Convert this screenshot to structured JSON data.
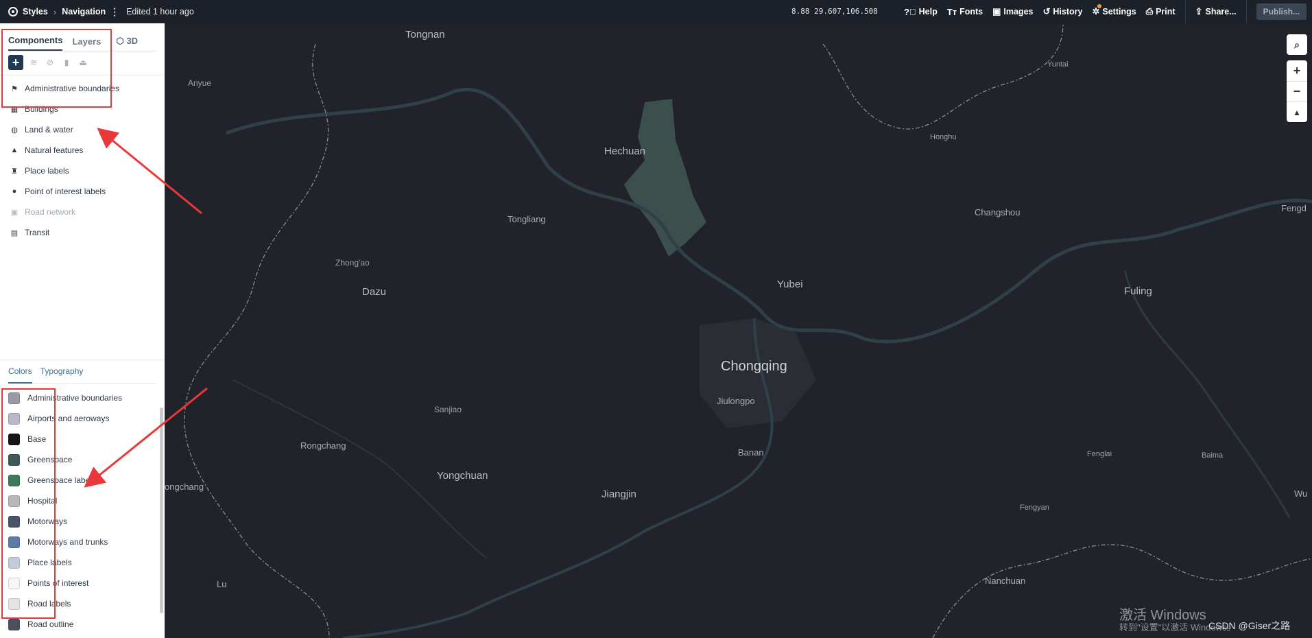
{
  "topbar": {
    "crumb_styles": "Styles",
    "crumb_navigation": "Navigation",
    "edited": "Edited 1 hour ago",
    "coords": "8.88 29.607,106.508",
    "menu": [
      {
        "label": "Help",
        "icon": "help-icon"
      },
      {
        "label": "Fonts",
        "icon": "fonts-icon"
      },
      {
        "label": "Images",
        "icon": "images-icon"
      },
      {
        "label": "History",
        "icon": "history-icon"
      },
      {
        "label": "Settings",
        "icon": "settings-icon"
      },
      {
        "label": "Print",
        "icon": "print-icon"
      },
      {
        "label": "Share...",
        "icon": "share-icon"
      }
    ],
    "publish": "Publish..."
  },
  "sidebar": {
    "tabs": [
      "Components",
      "Layers",
      "3D"
    ],
    "components": [
      {
        "label": "Administrative boundaries",
        "icon": "flag-icon"
      },
      {
        "label": "Buildings",
        "icon": "building-icon"
      },
      {
        "label": "Land & water",
        "icon": "globe-icon"
      },
      {
        "label": "Natural features",
        "icon": "mountain-icon"
      },
      {
        "label": "Place labels",
        "icon": "place-label-icon"
      },
      {
        "label": "Point of interest labels",
        "icon": "marker-icon"
      },
      {
        "label": "Road network",
        "icon": "car-icon",
        "disabled": true
      },
      {
        "label": "Transit",
        "icon": "train-icon"
      }
    ],
    "bottom_tabs": [
      "Colors",
      "Typography"
    ],
    "colors": [
      {
        "label": "Administrative boundaries",
        "color": "#9a9aa6"
      },
      {
        "label": "Airports and aeroways",
        "color": "#b8b8cc"
      },
      {
        "label": "Base",
        "color": "#16161a"
      },
      {
        "label": "Greenspace",
        "color": "#3f5a56"
      },
      {
        "label": "Greenspace labels",
        "color": "#3d7a5c"
      },
      {
        "label": "Hospital",
        "color": "#b9b7bd"
      },
      {
        "label": "Motorways",
        "color": "#4a5468"
      },
      {
        "label": "Motorways and trunks",
        "color": "#5d7aa8"
      },
      {
        "label": "Place labels",
        "color": "#c3cad8"
      },
      {
        "label": "Points of interest",
        "color": "#f6f6f7"
      },
      {
        "label": "Road labels",
        "color": "#e4e4e6"
      },
      {
        "label": "Road outline",
        "color": "#4b5060"
      }
    ]
  },
  "map": {
    "labels": {
      "tongnan": "Tongnan",
      "anyue": "Anyue",
      "hechuan": "Hechuan",
      "yuntai": "Yuntai",
      "honghu": "Honghu",
      "tongliang": "Tongliang",
      "changshou": "Changshou",
      "fengd": "Fengd",
      "zhongao": "Zhong'ao",
      "dazu": "Dazu",
      "yubei": "Yubei",
      "fuling": "Fuling",
      "chongqing": "Chongqing",
      "jiulongpo": "Jiulongpo",
      "sanjiao": "Sanjiao",
      "rongchang": "Rongchang",
      "banan": "Banan",
      "fenglai": "Fenglai",
      "baima": "Baima",
      "yongchuan": "Yongchuan",
      "jiangjin": "Jiangjin",
      "ongchang": "ongchang",
      "fengyan": "Fengyan",
      "wu": "Wu",
      "lu": "Lu",
      "nanchuan": "Nanchuan"
    },
    "watermark_line1": "激活 Windows",
    "watermark_line2": "转到\"设置\"以激活 Windows。",
    "credit": "CSDN @Giser之路"
  }
}
